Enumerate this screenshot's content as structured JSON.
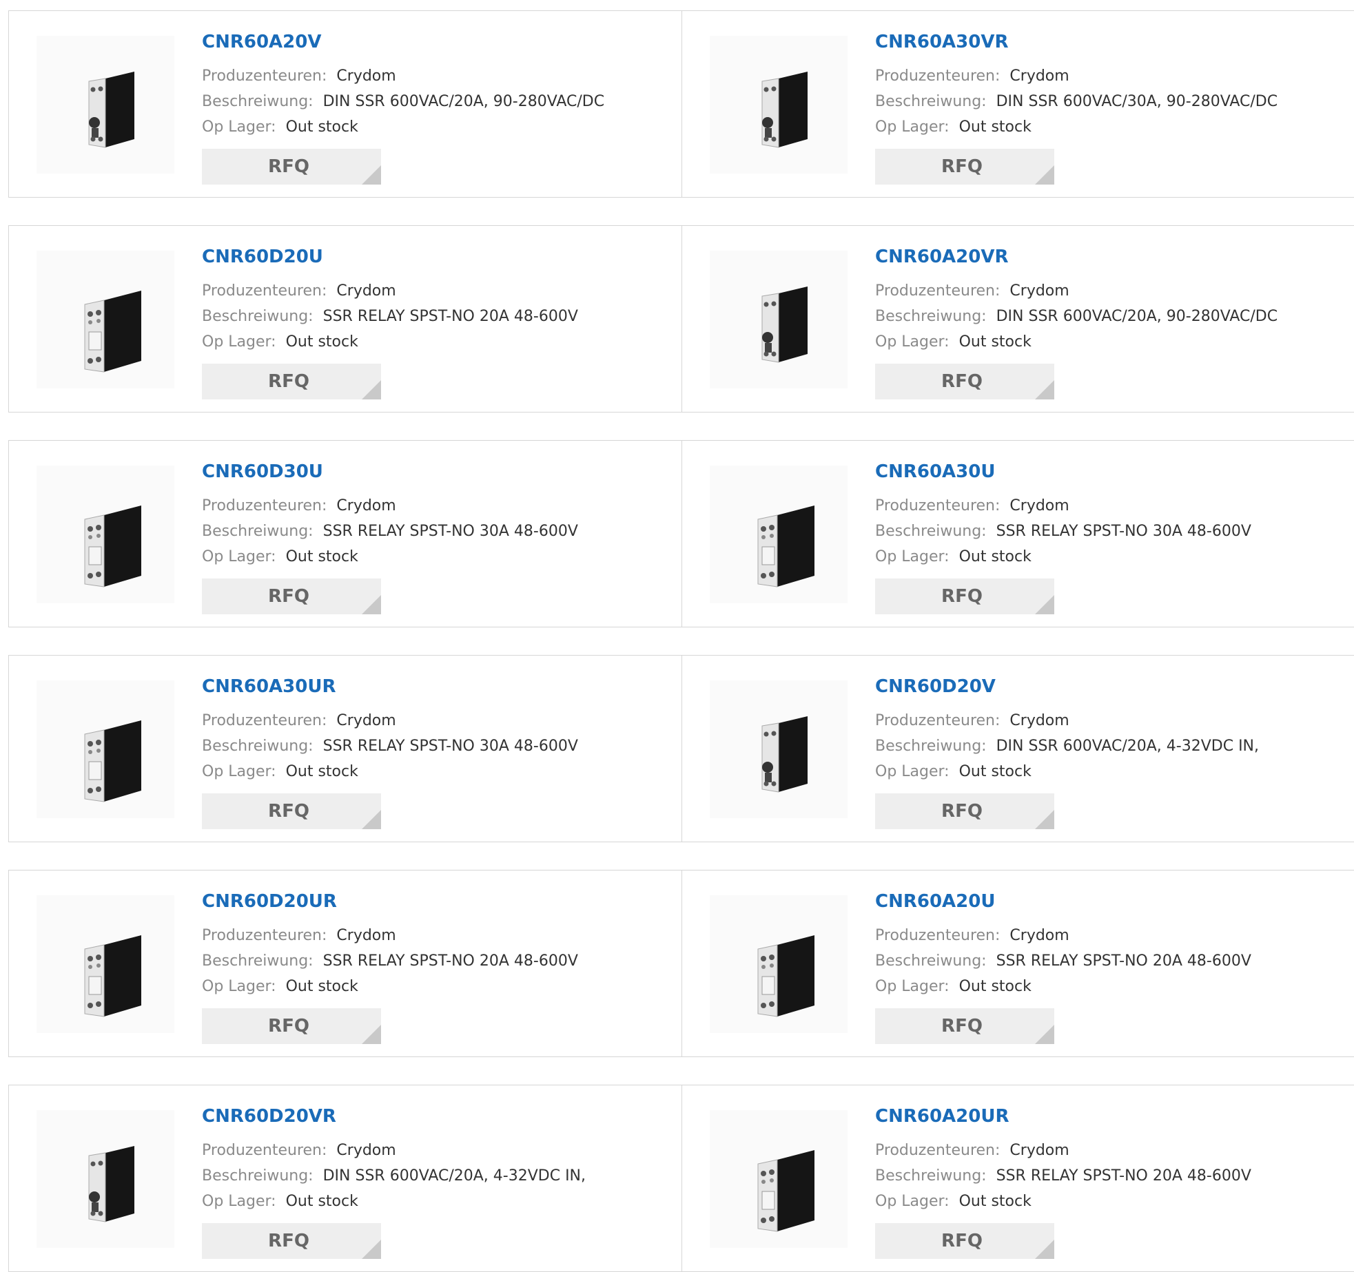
{
  "labels": {
    "manufacturer": "Produzenteuren:",
    "description": "Beschreiwung:",
    "stock": "Op Lager:",
    "rfq": "RFQ"
  },
  "colors": {
    "part_link": "#1a6bb8",
    "label": "#8a8a8a",
    "button_bg": "#eeeeee",
    "border": "#d6d6d6"
  },
  "products": [
    {
      "part": "CNR60A20V",
      "manufacturer": "Crydom",
      "description": "DIN SSR 600VAC/20A, 90-280VAC/DC",
      "stock": "Out stock",
      "image": "din-relay-icon"
    },
    {
      "part": "CNR60A30VR",
      "manufacturer": "Crydom",
      "description": "DIN SSR 600VAC/30A, 90-280VAC/DC",
      "stock": "Out stock",
      "image": "din-relay-icon"
    },
    {
      "part": "CNR60D20U",
      "manufacturer": "Crydom",
      "description": "SSR RELAY SPST-NO 20A 48-600V",
      "stock": "Out stock",
      "image": "panel-relay-icon"
    },
    {
      "part": "CNR60A20VR",
      "manufacturer": "Crydom",
      "description": "DIN SSR 600VAC/20A, 90-280VAC/DC",
      "stock": "Out stock",
      "image": "din-relay-icon"
    },
    {
      "part": "CNR60D30U",
      "manufacturer": "Crydom",
      "description": "SSR RELAY SPST-NO 30A 48-600V",
      "stock": "Out stock",
      "image": "panel-relay-icon"
    },
    {
      "part": "CNR60A30U",
      "manufacturer": "Crydom",
      "description": "SSR RELAY SPST-NO 30A 48-600V",
      "stock": "Out stock",
      "image": "panel-relay-icon"
    },
    {
      "part": "CNR60A30UR",
      "manufacturer": "Crydom",
      "description": "SSR RELAY SPST-NO 30A 48-600V",
      "stock": "Out stock",
      "image": "panel-relay-icon"
    },
    {
      "part": "CNR60D20V",
      "manufacturer": "Crydom",
      "description": "DIN SSR 600VAC/20A, 4-32VDC IN,",
      "stock": "Out stock",
      "image": "din-relay-icon"
    },
    {
      "part": "CNR60D20UR",
      "manufacturer": "Crydom",
      "description": "SSR RELAY SPST-NO 20A 48-600V",
      "stock": "Out stock",
      "image": "panel-relay-icon"
    },
    {
      "part": "CNR60A20U",
      "manufacturer": "Crydom",
      "description": "SSR RELAY SPST-NO 20A 48-600V",
      "stock": "Out stock",
      "image": "panel-relay-icon"
    },
    {
      "part": "CNR60D20VR",
      "manufacturer": "Crydom",
      "description": "DIN SSR 600VAC/20A, 4-32VDC IN,",
      "stock": "Out stock",
      "image": "din-relay-icon"
    },
    {
      "part": "CNR60A20UR",
      "manufacturer": "Crydom",
      "description": "SSR RELAY SPST-NO 20A 48-600V",
      "stock": "Out stock",
      "image": "panel-relay-icon"
    }
  ]
}
